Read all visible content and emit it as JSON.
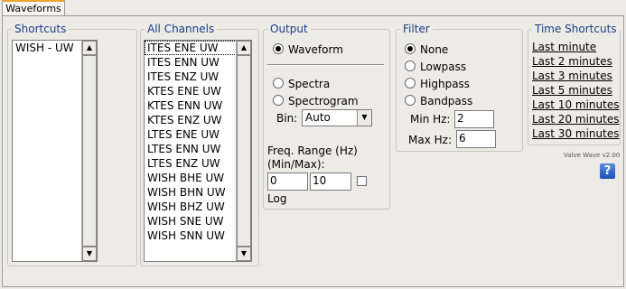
{
  "tab": {
    "label": "Waveforms"
  },
  "shortcuts": {
    "legend": "Shortcuts",
    "items": [
      "WISH - UW"
    ]
  },
  "channels": {
    "legend": "All Channels",
    "items": [
      "ITES ENE UW",
      "ITES ENN UW",
      "ITES ENZ UW",
      "KTES ENE UW",
      "KTES ENN UW",
      "KTES ENZ UW",
      "LTES ENE UW",
      "LTES ENN UW",
      "LTES ENZ UW",
      "WISH BHE UW",
      "WISH BHN UW",
      "WISH BHZ UW",
      "WISH SNE UW",
      "WISH SNN UW"
    ]
  },
  "output": {
    "legend": "Output",
    "waveform_label": "Waveform",
    "spectra_label": "Spectra",
    "spectrogram_label": "Spectrogram",
    "bin_label": "Bin:",
    "bin_value": "Auto",
    "freq_range_label": "Freq. Range (Hz)",
    "min_max_label": "(Min/Max):",
    "freq_min": "0",
    "freq_max": "10",
    "log_label": "Log",
    "selected": "waveform"
  },
  "filter": {
    "legend": "Filter",
    "none_label": "None",
    "lowpass_label": "Lowpass",
    "highpass_label": "Highpass",
    "bandpass_label": "Bandpass",
    "min_hz_label": "Min Hz:",
    "min_hz_value": "2",
    "max_hz_label": "Max Hz:",
    "max_hz_value": "6",
    "selected": "none"
  },
  "time_shortcuts": {
    "legend": "Time Shortcuts",
    "items": [
      "Last minute",
      "Last 2 minutes",
      "Last 3 minutes",
      "Last 5 minutes",
      "Last 10 minutes",
      "Last 20 minutes",
      "Last 30 minutes"
    ]
  },
  "version": "Valve Wave v2.00",
  "help_icon": "?"
}
